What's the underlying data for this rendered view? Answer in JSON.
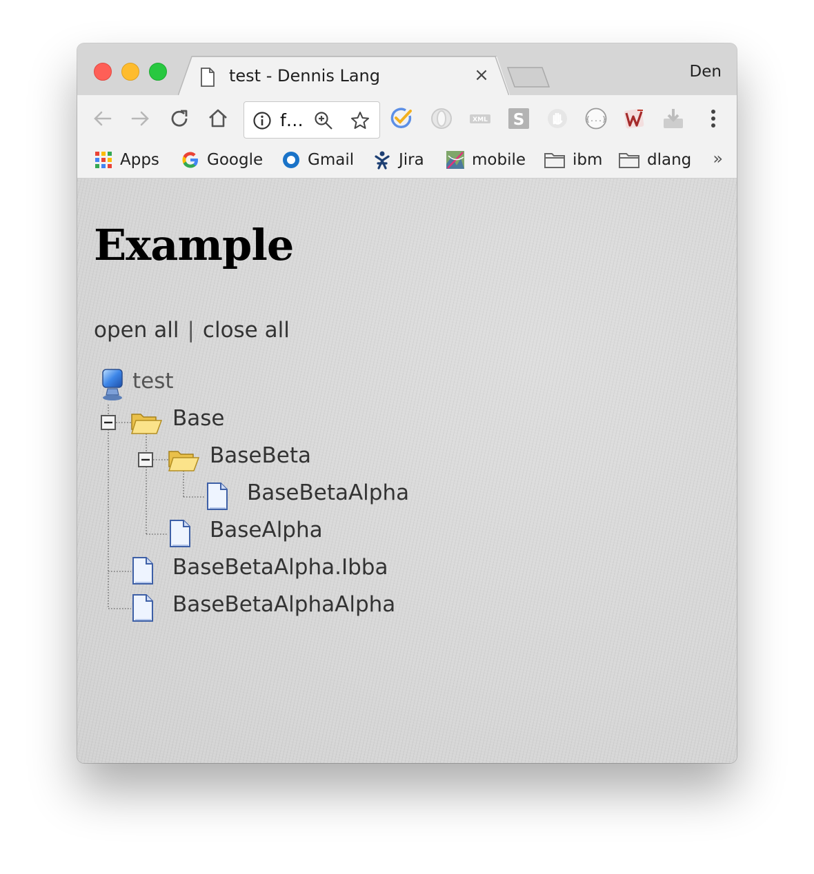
{
  "window": {
    "tab_title": "test - Dennis Lang",
    "tab_close": "×",
    "profile_name": "Den"
  },
  "toolbar": {
    "url_display": "f…"
  },
  "bookmarks": {
    "items": [
      {
        "label": "Apps",
        "icon": "apps-grid-icon"
      },
      {
        "label": "Google",
        "icon": "google-icon"
      },
      {
        "label": "Gmail",
        "icon": "gmail-icon"
      },
      {
        "label": "Jira",
        "icon": "jira-icon"
      },
      {
        "label": "mobile",
        "icon": "image-icon"
      },
      {
        "label": "ibm",
        "icon": "folder-icon"
      },
      {
        "label": "dlang",
        "icon": "folder-icon"
      }
    ],
    "more": "»"
  },
  "page": {
    "title": "Example",
    "open_all": "open all",
    "separator": "|",
    "close_all": "close all"
  },
  "tree": {
    "root": "test",
    "nodes": [
      {
        "label": "Base",
        "type": "folder-open"
      },
      {
        "label": "BaseBeta",
        "type": "folder-open"
      },
      {
        "label": "BaseBetaAlpha",
        "type": "page"
      },
      {
        "label": "BaseAlpha",
        "type": "page"
      },
      {
        "label": "BaseBetaAlpha.Ibba",
        "type": "page"
      },
      {
        "label": "BaseBetaAlphaAlpha",
        "type": "page"
      }
    ]
  },
  "colors": {
    "close_light": "#fe5f57",
    "minimize_light": "#febc2e",
    "zoom_light": "#28c840",
    "tree_text": "#333333"
  }
}
